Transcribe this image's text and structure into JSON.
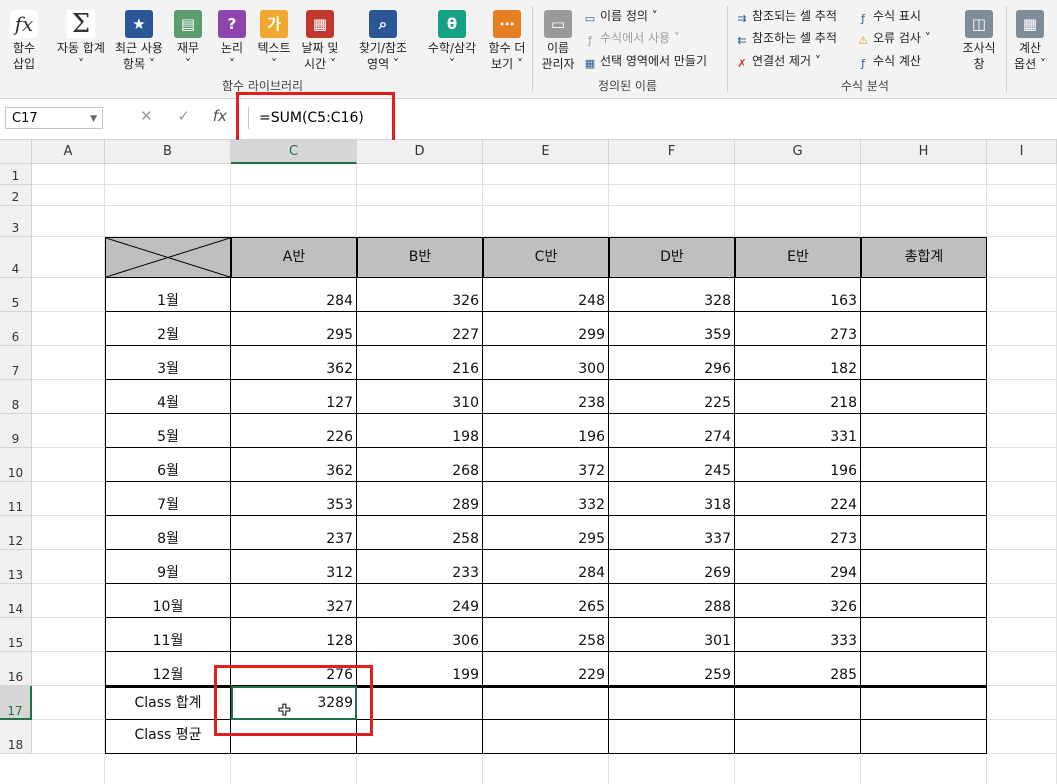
{
  "ribbon": {
    "big_buttons": [
      {
        "label1": "함수",
        "label2": "삽입",
        "icon": "fx-icon"
      },
      {
        "label1": "자동 합계",
        "label2": "˅",
        "icon": "sigma-icon"
      },
      {
        "label1": "최근 사용",
        "label2": "항목 ˅",
        "icon": "star-icon"
      },
      {
        "label1": "재무",
        "label2": "˅",
        "icon": "finance-icon"
      },
      {
        "label1": "논리",
        "label2": "˅",
        "icon": "logic-icon"
      },
      {
        "label1": "텍스트",
        "label2": "˅",
        "icon": "text-icon"
      },
      {
        "label1": "날짜 및",
        "label2": "시간 ˅",
        "icon": "calendar-icon"
      },
      {
        "label1": "찾기/참조",
        "label2": "영역 ˅",
        "icon": "lookup-icon"
      },
      {
        "label1": "수학/삼각",
        "label2": "˅",
        "icon": "math-icon"
      },
      {
        "label1": "함수 더",
        "label2": "보기 ˅",
        "icon": "more-functions-icon"
      }
    ],
    "name_manager": {
      "label1": "이름",
      "label2": "관리자"
    },
    "defined_names": [
      "이름 정의 ˅",
      "수식에서 사용 ˅",
      "선택 영역에서 만들기"
    ],
    "audit_col1": [
      "참조되는 셀 추적",
      "참조하는 셀 추적",
      "연결선 제거 ˅"
    ],
    "audit_col2": [
      "수식 표시",
      "오류 검사 ˅",
      "수식 계산"
    ],
    "watch": {
      "label1": "조사식",
      "label2": "창"
    },
    "calc": {
      "label1": "계산",
      "label2": "옵션 ˅"
    },
    "groups": [
      "함수 라이브러리",
      "정의된 이름",
      "수식 분석"
    ],
    "icon_glyphs": {
      "fx": "fx",
      "sigma": "Σ",
      "star": "★",
      "finance": "▤",
      "logic": "?",
      "text": "가",
      "calendar": "▦",
      "lookup": "⌕",
      "math": "θ",
      "more": "⋯",
      "name_mgr": "▭",
      "watch": "◫",
      "calc": "▦"
    }
  },
  "formula_bar": {
    "name_box": "C17",
    "formula": "=SUM(C5:C16)",
    "cancel": "✕",
    "enter": "✓",
    "fx": "fx"
  },
  "columns": [
    "A",
    "B",
    "C",
    "D",
    "E",
    "F",
    "G",
    "H",
    "I"
  ],
  "rows": [
    "1",
    "2",
    "3",
    "4",
    "5",
    "6",
    "7",
    "8",
    "9",
    "10",
    "11",
    "12",
    "13",
    "14",
    "15",
    "16",
    "17",
    "18"
  ],
  "table": {
    "headers": [
      "A반",
      "B반",
      "C반",
      "D반",
      "E반",
      "총합계"
    ],
    "row_labels": [
      "1월",
      "2월",
      "3월",
      "4월",
      "5월",
      "6월",
      "7월",
      "8월",
      "9월",
      "10월",
      "11월",
      "12월"
    ],
    "values": [
      [
        284,
        326,
        248,
        328,
        163
      ],
      [
        295,
        227,
        299,
        359,
        273
      ],
      [
        362,
        216,
        300,
        296,
        182
      ],
      [
        127,
        310,
        238,
        225,
        218
      ],
      [
        226,
        198,
        196,
        274,
        331
      ],
      [
        362,
        268,
        372,
        245,
        196
      ],
      [
        353,
        289,
        332,
        318,
        224
      ],
      [
        237,
        258,
        295,
        337,
        273
      ],
      [
        312,
        233,
        284,
        269,
        294
      ],
      [
        327,
        249,
        265,
        288,
        326
      ],
      [
        128,
        306,
        258,
        301,
        333
      ],
      [
        276,
        199,
        229,
        259,
        285
      ]
    ],
    "sum_label": "Class 합계",
    "avg_label": "Class 평균",
    "sum_value": "3289"
  },
  "colors": {
    "accent": "#217346",
    "header_fill": "#bfbfbf",
    "highlight": "#e02020"
  }
}
